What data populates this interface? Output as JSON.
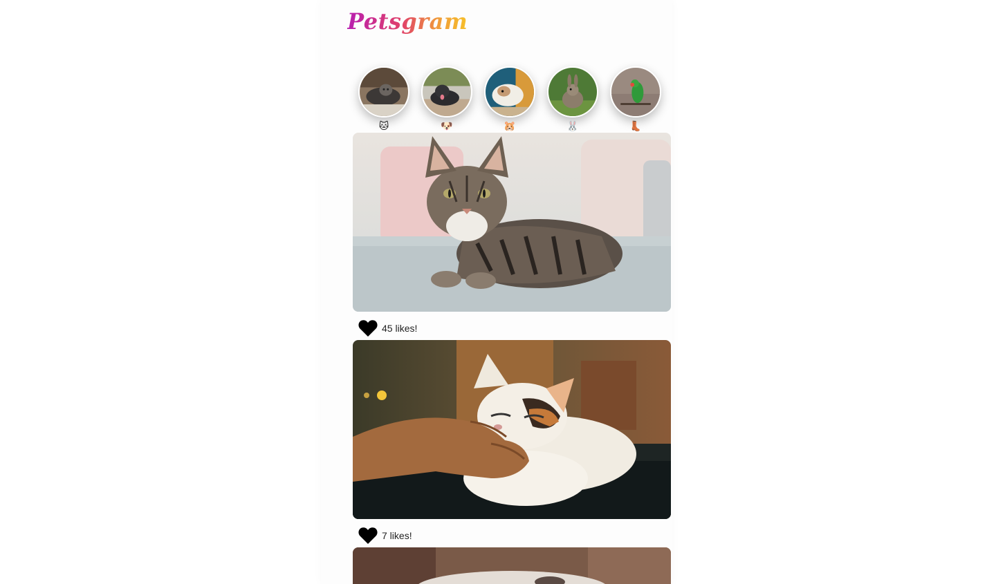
{
  "app": {
    "logo": "Petsgram"
  },
  "stories": [
    {
      "emoji": "🐱",
      "icon": "cat-face-icon",
      "photo": "cat"
    },
    {
      "emoji": "🐶",
      "icon": "dog-face-icon",
      "photo": "dog"
    },
    {
      "emoji": "🐹",
      "icon": "hamster-face-icon",
      "photo": "hamster"
    },
    {
      "emoji": "🐰",
      "icon": "rabbit-face-icon",
      "photo": "rabbit"
    },
    {
      "emoji": "👢",
      "icon": "boot-icon",
      "photo": "parrot"
    }
  ],
  "posts": [
    {
      "photo": "tabby cat on sofa",
      "likes_count": "45",
      "likes_suffix": " likes!"
    },
    {
      "photo": "calico cat being petted",
      "likes_count": "7",
      "likes_suffix": " likes!"
    },
    {
      "photo": "third post (partially visible)"
    }
  ],
  "colors": {
    "logo_gradient": [
      "#b81fb0",
      "#e0406a",
      "#f09a3a",
      "#f7c02a"
    ],
    "heart": "#000000"
  }
}
